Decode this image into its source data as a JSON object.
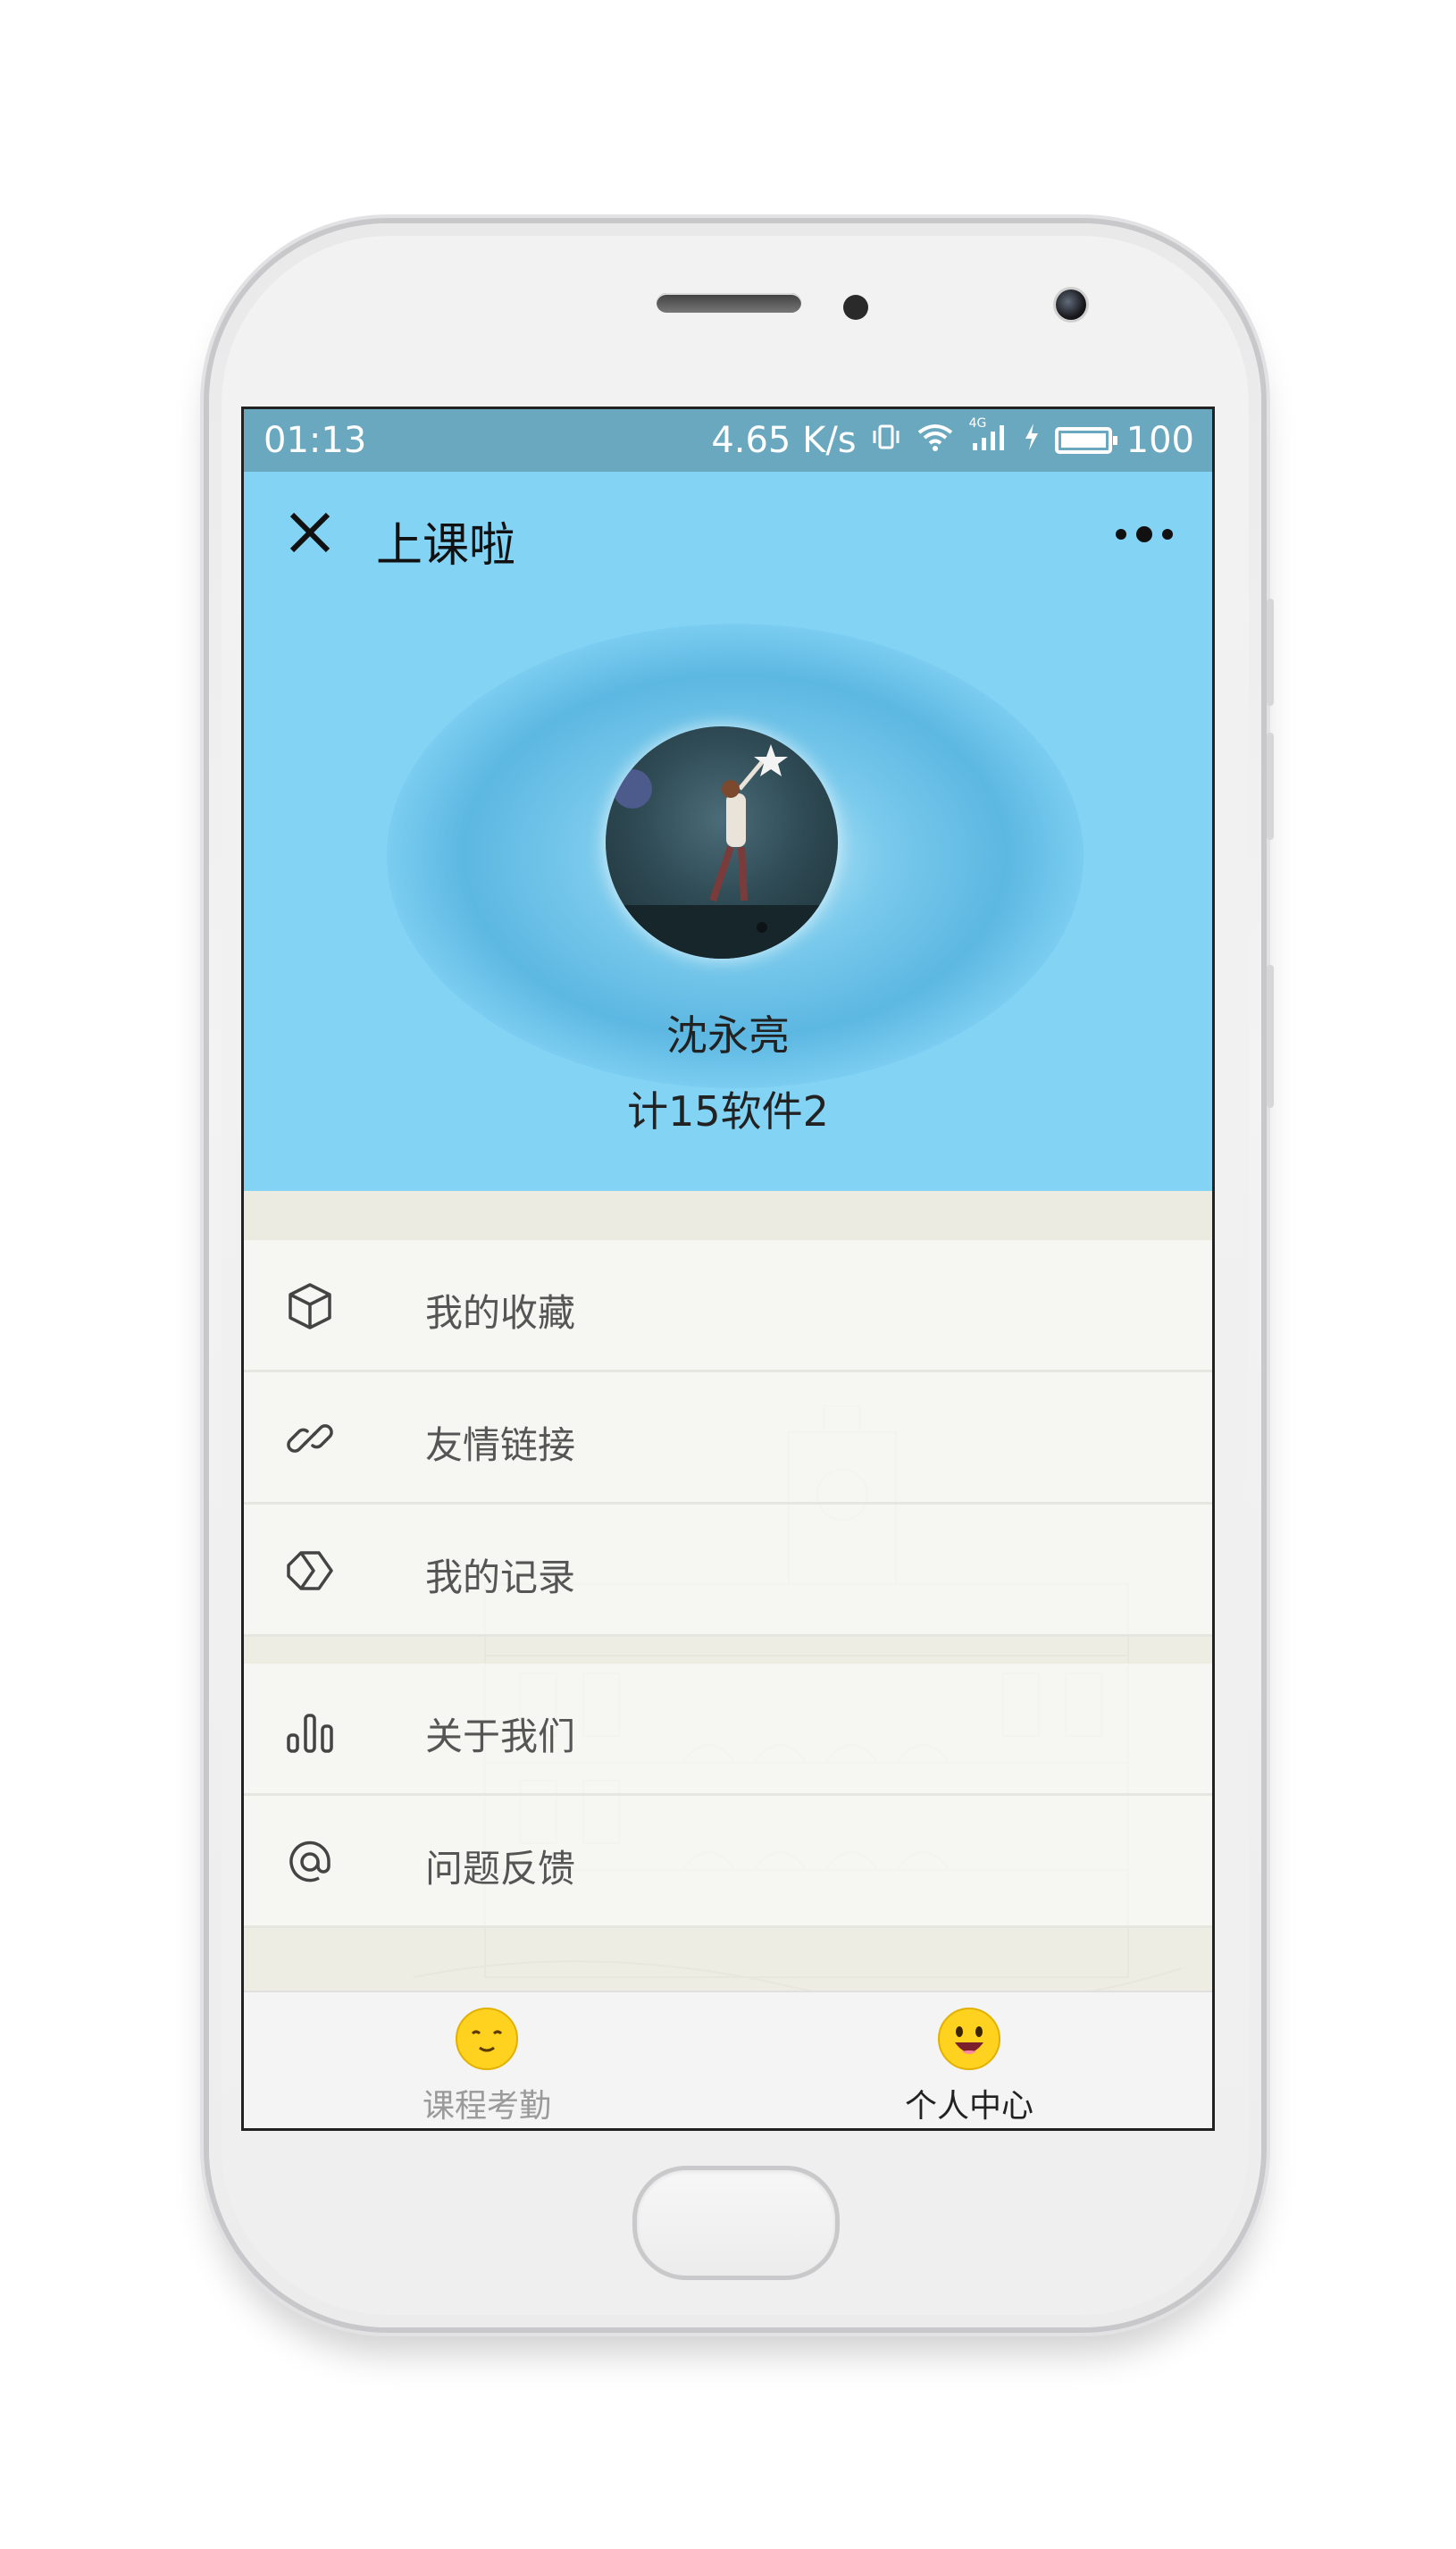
{
  "statusbar": {
    "time": "01:13",
    "network_speed": "4.65 K/s",
    "network_type": "4G",
    "battery": "100"
  },
  "header": {
    "app_title": "上课啦",
    "user_name": "沈永亮",
    "user_class": "计15软件2"
  },
  "menu": [
    {
      "label": "我的收藏",
      "icon": "cube-icon"
    },
    {
      "label": "友情链接",
      "icon": "link-icon"
    },
    {
      "label": "我的记录",
      "icon": "tag-icon"
    },
    {
      "label": "关于我们",
      "icon": "bar-chart-icon"
    },
    {
      "label": "问题反馈",
      "icon": "at-icon"
    }
  ],
  "tabbar": {
    "tabs": [
      {
        "label": "课程考勤",
        "icon": "smile-face-icon",
        "active": false
      },
      {
        "label": "个人中心",
        "icon": "happy-face-icon",
        "active": true
      }
    ]
  },
  "colors": {
    "status_bar": "#6aa8bf",
    "header_bg": "#83d3f4",
    "tab_active": "#222222",
    "tab_inactive": "#9a9a9a",
    "emoji_yellow": "#ffd21f"
  }
}
